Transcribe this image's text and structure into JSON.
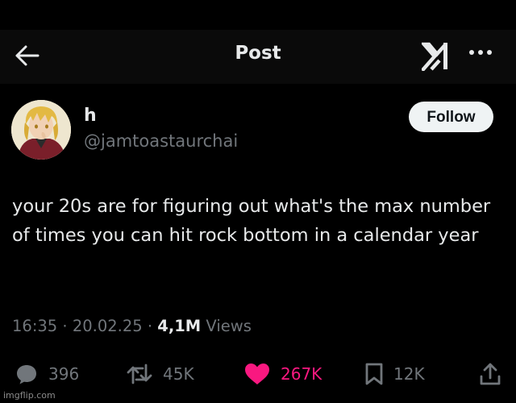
{
  "header": {
    "title": "Post",
    "back_icon": "arrow-left-icon",
    "logo_icon": "xai-logo-icon",
    "more_icon": "more-dots-icon"
  },
  "author": {
    "name": "h",
    "handle": "@jamtoastaurchai",
    "avatar": "anime-character-avatar"
  },
  "follow_label": "Follow",
  "post": {
    "text": "your 20s are for figuring out what's the max number of times you can hit rock bottom in a calendar year",
    "time": "16:35",
    "date": "20.02.25",
    "views_count": "4,1M",
    "views_label": "Views"
  },
  "actions": {
    "replies": "396",
    "reposts": "45K",
    "likes": "267K",
    "bookmarks": "12K"
  },
  "colors": {
    "background": "#000000",
    "text": "#e7e9ea",
    "secondary": "#71767b",
    "like": "#f91880",
    "follow_bg": "#eff3f4"
  },
  "watermark": "imgflip.com"
}
